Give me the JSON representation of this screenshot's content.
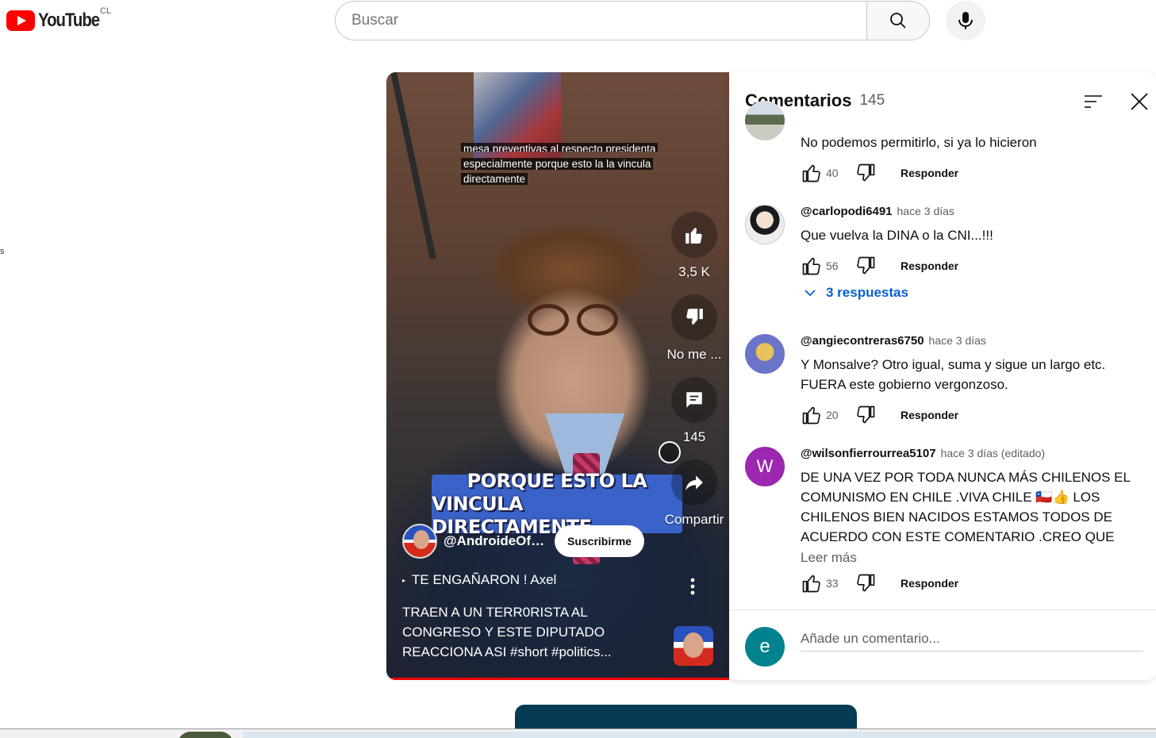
{
  "header": {
    "logo_text": "YouTube",
    "country_code": "CL",
    "search_placeholder": "Buscar"
  },
  "stray_text": "s",
  "short": {
    "caption_top": "mesa preventivas al respecto presidenta",
    "caption_line1": "especialmente porque esto la la vincula",
    "caption_line2": "directamente",
    "banner_line1": "PORQUE ESTO LA",
    "banner_line2": "VINCULA DIRECTAMENTE",
    "like_count": "3,5 K",
    "dislike_label": "No me ...",
    "comment_count": "145",
    "share_label": "Compartir",
    "channel_name": "@AndroideOffi...",
    "subscribe_label": "Suscribirme",
    "music_title": "TE ENGAÑARON ! Axel",
    "title": "TRAEN A UN TERR0RISTA AL CONGRESO Y ESTE DIPUTADO REACCIONA ASI #short #politics..."
  },
  "comments_panel": {
    "title": "Comentarios",
    "count": "145",
    "reply_label": "Responder",
    "add_placeholder": "Añade un comentario...",
    "user_initial": "e",
    "items": [
      {
        "handle": "",
        "time": "",
        "text": "No podemos permitirlo, si ya lo hicieron",
        "likes": "40"
      },
      {
        "handle": "@carlopodi6491",
        "time": "hace 3 días",
        "text": "Que vuelva la DINA o la CNI...!!!",
        "likes": "56",
        "replies": "3 respuestas"
      },
      {
        "handle": "@angiecontreras6750",
        "time": "hace 3 días",
        "text": "Y Monsalve? Otro igual, suma y sigue un largo etc. FUERA este gobierno vergonzoso.",
        "likes": "20"
      },
      {
        "handle": "@wilsonfierrourrea5107",
        "time": "hace 3 días (editado)",
        "text": "DE UNA VEZ POR TODA NUNCA MÁS CHILENOS EL COMUNISMO EN CHILE .VIVA CHILE 🇨🇱👍 LOS CHILENOS BIEN NACIDOS  ESTAMOS TODOS DE ACUERDO CON ESTE  COMENTARIO .CREO QUE EL ...",
        "likes": "33",
        "initial": "W",
        "read_more": "Leer más"
      }
    ]
  },
  "colors": {
    "brand_red": "#ff0000",
    "link_blue": "#065fd4",
    "avatar_purple": "#9c27b0",
    "avatar_teal": "#00838f"
  }
}
